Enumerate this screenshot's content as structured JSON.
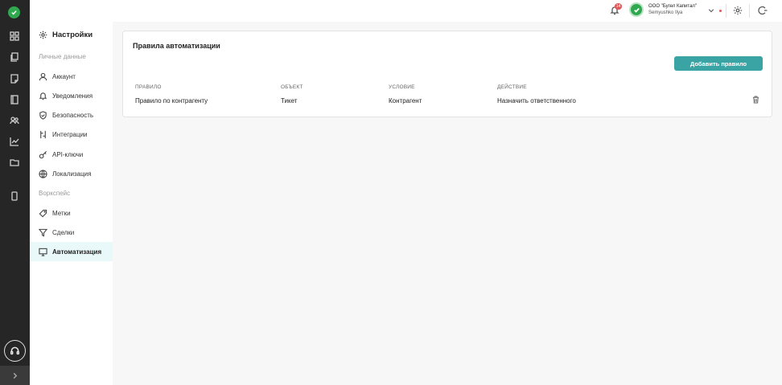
{
  "sidebar": {
    "title": "Настройки",
    "sections": [
      {
        "label": "Личные данные"
      },
      {
        "label": "Воркспейс"
      }
    ],
    "items": [
      {
        "label": "Аккаунт",
        "icon": "user-icon"
      },
      {
        "label": "Уведомления",
        "icon": "bell-icon"
      },
      {
        "label": "Безопасность",
        "icon": "shield-icon"
      },
      {
        "label": "Интеграции",
        "icon": "integrations-icon"
      },
      {
        "label": "API-ключи",
        "icon": "key-icon"
      },
      {
        "label": "Локализация",
        "icon": "globe-icon"
      },
      {
        "label": "Метки",
        "icon": "tag-icon"
      },
      {
        "label": "Сделки",
        "icon": "funnel-icon"
      },
      {
        "label": "Автоматизация",
        "icon": "monitor-icon",
        "active": true
      }
    ]
  },
  "topbar": {
    "notifications_count": "14",
    "company_name": "ООО \"Бугел Капитал\"",
    "user_name": "Semyushko Ilya"
  },
  "card": {
    "title": "Правила автоматизации",
    "add_button": "Добавить правило",
    "columns": [
      "ПРАВИЛО",
      "ОБЪЕКТ",
      "УСЛОВИЕ",
      "ДЕЙСТВИЕ"
    ],
    "rows": [
      {
        "rule": "Правило по контрагенту",
        "object": "Тикет",
        "condition": "Контрагент",
        "action": "Назначить ответственного"
      }
    ]
  },
  "colors": {
    "accent": "#3aa3a3",
    "rail": "#262626",
    "active_item_bg": "#e9f8f8",
    "logo_green": "#2fa84f",
    "badge_red": "#e25757"
  }
}
